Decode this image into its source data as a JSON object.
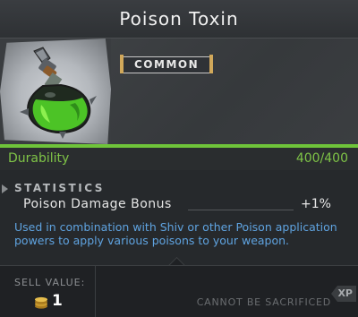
{
  "item": {
    "name": "Poison Toxin",
    "rarity": "COMMON",
    "icon": "poison-potion-icon"
  },
  "durability": {
    "label": "Durability",
    "value": "400/400",
    "fraction": 1.0
  },
  "statistics": {
    "heading": "STATISTICS",
    "rows": [
      {
        "name": "Poison Damage Bonus",
        "value": "+1%"
      }
    ]
  },
  "description": "Used in combination with Shiv or other Poison application powers to apply various poisons to your weapon.",
  "footer": {
    "sell_label": "SELL VALUE:",
    "sell_value": "1",
    "sell_icon": "coin-stack-icon",
    "sacrifice_text": "CANNOT BE SACRIFICED",
    "xp_label": "XP"
  },
  "colors": {
    "durability_green": "#7fc447",
    "description_blue": "#5fa3e0",
    "rarity_gold": "#d1a85a"
  }
}
